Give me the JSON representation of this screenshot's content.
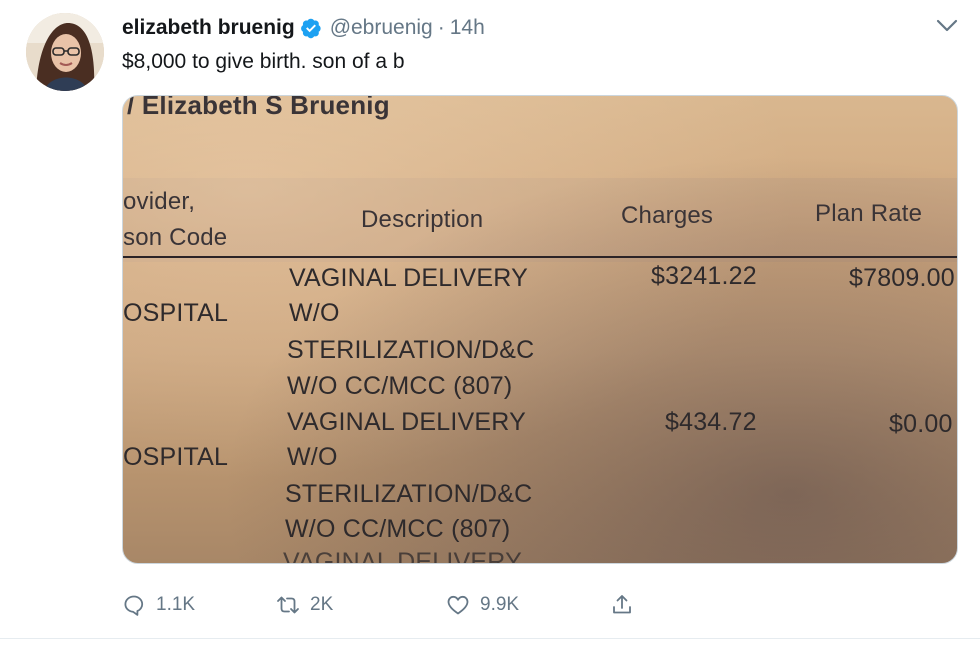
{
  "tweet": {
    "display_name": "elizabeth bruenig",
    "handle": "@ebruenig",
    "separator": "·",
    "time": "14h",
    "text": "$8,000 to give birth. son of a b"
  },
  "media": {
    "doc_name": "Elizabeth S Bruenig",
    "col_provider_line1": "ovider,",
    "col_provider_line2": "son Code",
    "col_description": "Description",
    "col_charges": "Charges",
    "col_plan_rate": "Plan Rate",
    "rows": [
      {
        "provider": "OSPITAL",
        "desc_lines": [
          "VAGINAL DELIVERY",
          "W/O",
          "STERILIZATION/D&C",
          "W/O CC/MCC (807)"
        ],
        "charges": "$3241.22",
        "plan_rate": "$7809.00"
      },
      {
        "provider": "OSPITAL",
        "desc_lines": [
          "VAGINAL DELIVERY",
          "W/O",
          "STERILIZATION/D&C",
          "W/O CC/MCC (807)"
        ],
        "charges": "$434.72",
        "plan_rate": "$0.00"
      }
    ],
    "cut_line": "VAGINAL DELIVERY"
  },
  "actions": {
    "reply_count": "1.1K",
    "retweet_count": "2K",
    "like_count": "9.9K"
  },
  "icons": {
    "reply": "reply-icon",
    "retweet": "retweet-icon",
    "like": "heart-icon",
    "share": "share-icon",
    "verified": "verified-badge-icon",
    "caret": "chevron-down-icon"
  },
  "colors": {
    "verified_blue": "#1da1f2",
    "muted": "#657786",
    "text": "#14171a"
  }
}
